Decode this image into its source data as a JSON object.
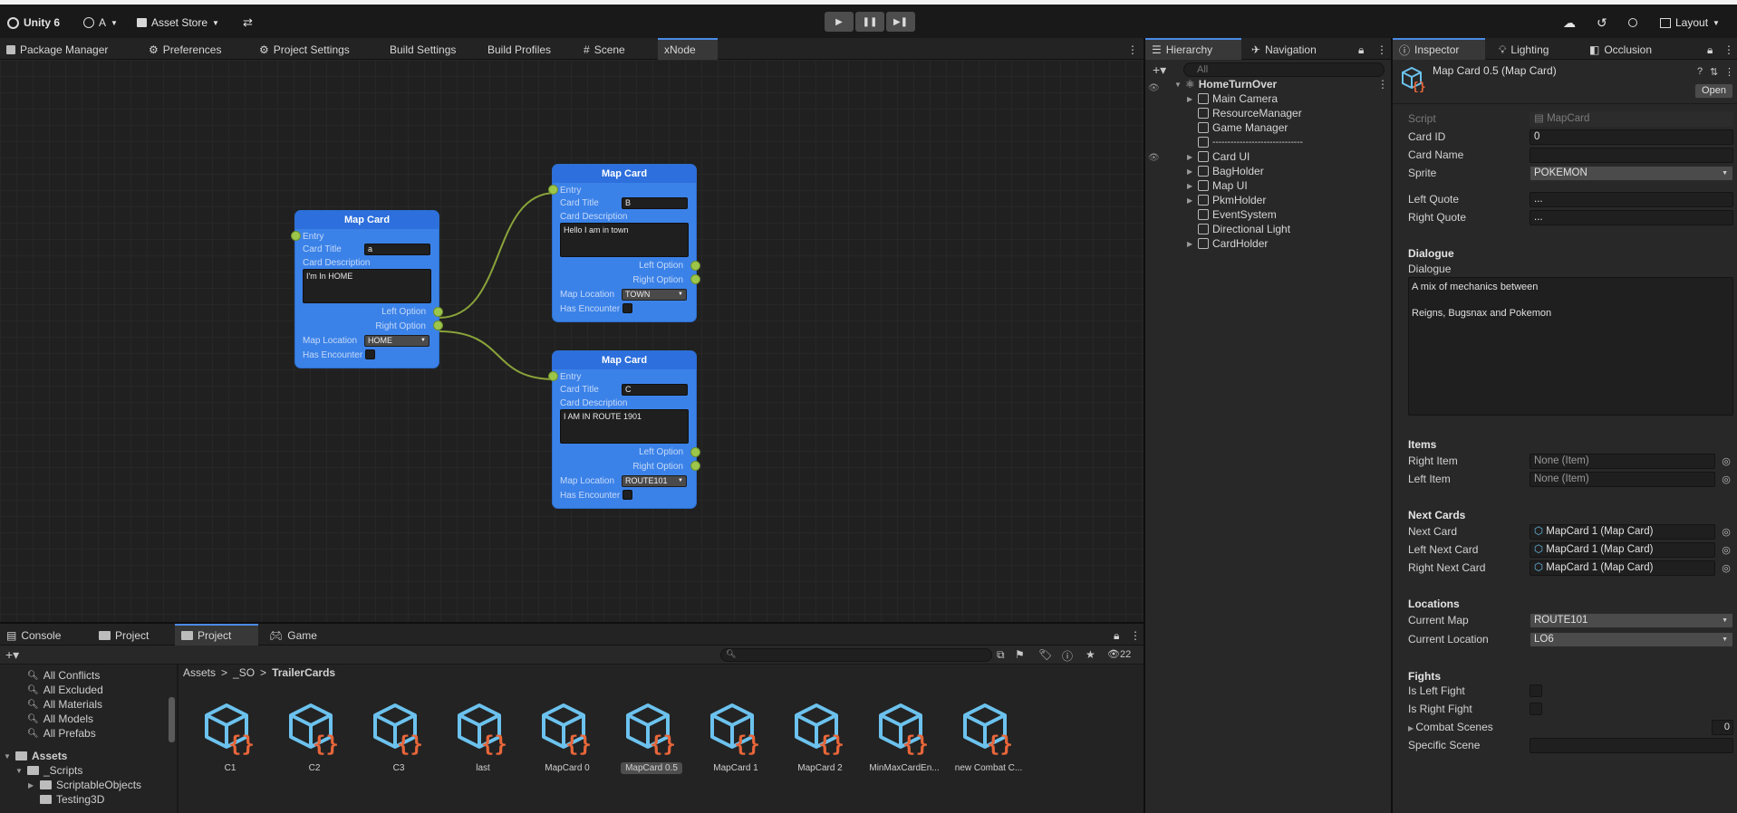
{
  "toolbar": {
    "app_title": "Unity 6",
    "account": "A",
    "asset_store": "Asset Store",
    "layout": "Layout"
  },
  "main_tabs": [
    {
      "label": "Package Manager"
    },
    {
      "label": "Preferences"
    },
    {
      "label": "Project Settings"
    },
    {
      "label": "Build Settings"
    },
    {
      "label": "Build Profiles"
    },
    {
      "label": "Scene"
    },
    {
      "label": "xNode"
    }
  ],
  "nodes": [
    {
      "title": "Map Card",
      "entry": "Entry",
      "card_title_label": "Card Title",
      "card_title_value": "a",
      "desc_label": "Card Description",
      "desc_value": "I'm In HOME",
      "left_option": "Left Option",
      "right_option": "Right Option",
      "location_label": "Map Location",
      "location_value": "HOME",
      "encounter_label": "Has Encounter"
    },
    {
      "title": "Map Card",
      "entry": "Entry",
      "card_title_label": "Card Title",
      "card_title_value": "B",
      "desc_label": "Card Description",
      "desc_value": "Hello I am in town",
      "left_option": "Left Option",
      "right_option": "Right Option",
      "location_label": "Map Location",
      "location_value": "TOWN",
      "encounter_label": "Has Encounter"
    },
    {
      "title": "Map Card",
      "entry": "Entry",
      "card_title_label": "Card Title",
      "card_title_value": "C",
      "desc_label": "Card Description",
      "desc_value": "I AM IN ROUTE 1901",
      "left_option": "Left Option",
      "right_option": "Right Option",
      "location_label": "Map Location",
      "location_value": "ROUTE101",
      "encounter_label": "Has Encounter"
    }
  ],
  "hierarchy": {
    "tabs": [
      "Hierarchy",
      "Navigation"
    ],
    "search_placeholder": "All",
    "root": "HomeTurnOver",
    "items": [
      {
        "label": "Main Camera"
      },
      {
        "label": "ResourceManager"
      },
      {
        "label": "Game Manager"
      },
      {
        "label": "------------------------------"
      },
      {
        "label": "Card UI"
      },
      {
        "label": "BagHolder"
      },
      {
        "label": "Map UI"
      },
      {
        "label": "PkmHolder"
      },
      {
        "label": "EventSystem"
      },
      {
        "label": "Directional Light"
      },
      {
        "label": "CardHolder"
      }
    ]
  },
  "inspector": {
    "tabs": [
      "Inspector",
      "Lighting",
      "Occlusion"
    ],
    "object_title": "Map Card 0.5 (Map Card)",
    "open_button": "Open",
    "script_label": "Script",
    "script_value": "MapCard",
    "card_id_label": "Card ID",
    "card_id_value": "0",
    "card_name_label": "Card Name",
    "card_name_value": "",
    "sprite_label": "Sprite",
    "sprite_value": "POKEMON",
    "left_quote_label": "Left Quote",
    "left_quote_value": "...",
    "right_quote_label": "Right Quote",
    "right_quote_value": "...",
    "dialogue_header": "Dialogue",
    "dialogue_label": "Dialogue",
    "dialogue_line1": "A mix of mechanics between",
    "dialogue_line2": "Reigns, Bugsnax and Pokemon",
    "items_header": "Items",
    "right_item_label": "Right Item",
    "right_item_value": "None (Item)",
    "left_item_label": "Left Item",
    "left_item_value": "None (Item)",
    "next_cards_header": "Next Cards",
    "next_card_label": "Next Card",
    "next_card_value": "MapCard 1 (Map Card)",
    "left_next_label": "Left Next Card",
    "left_next_value": "MapCard 1 (Map Card)",
    "right_next_label": "Right Next Card",
    "right_next_value": "MapCard 1 (Map Card)",
    "locations_header": "Locations",
    "current_map_label": "Current Map",
    "current_map_value": "ROUTE101",
    "current_location_label": "Current Location",
    "current_location_value": "LO6",
    "fights_header": "Fights",
    "is_left_fight_label": "Is Left Fight",
    "is_right_fight_label": "Is Right Fight",
    "combat_scenes_label": "Combat Scenes",
    "combat_scenes_count": "0",
    "specific_scene_label": "Specific Scene",
    "specific_scene_value": ""
  },
  "bottom_tabs": [
    {
      "label": "Console"
    },
    {
      "label": "Project"
    },
    {
      "label": "Project"
    },
    {
      "label": "Game"
    }
  ],
  "project": {
    "hidden_count": "22",
    "breadcrumb": [
      "Assets",
      "_SO",
      "TrailerCards"
    ],
    "sidebar": [
      {
        "label": "All Conflicts"
      },
      {
        "label": "All Excluded"
      },
      {
        "label": "All Materials"
      },
      {
        "label": "All Models"
      },
      {
        "label": "All Prefabs"
      }
    ],
    "assets_root": "Assets",
    "tree": [
      {
        "label": "_Scripts"
      },
      {
        "label": "ScriptableObjects"
      },
      {
        "label": "Testing3D"
      }
    ],
    "assets": [
      {
        "label": "C1"
      },
      {
        "label": "C2"
      },
      {
        "label": "C3"
      },
      {
        "label": "last"
      },
      {
        "label": "MapCard 0"
      },
      {
        "label": "MapCard 0.5"
      },
      {
        "label": "MapCard 1"
      },
      {
        "label": "MapCard 2"
      },
      {
        "label": "MinMaxCardEn..."
      },
      {
        "label": "new Combat C..."
      }
    ]
  },
  "colors": {
    "node_blue": "#3b82e8",
    "port_green": "#9cc64a",
    "script_orange": "#e8663a",
    "asset_cube": "#6cc2ee"
  }
}
